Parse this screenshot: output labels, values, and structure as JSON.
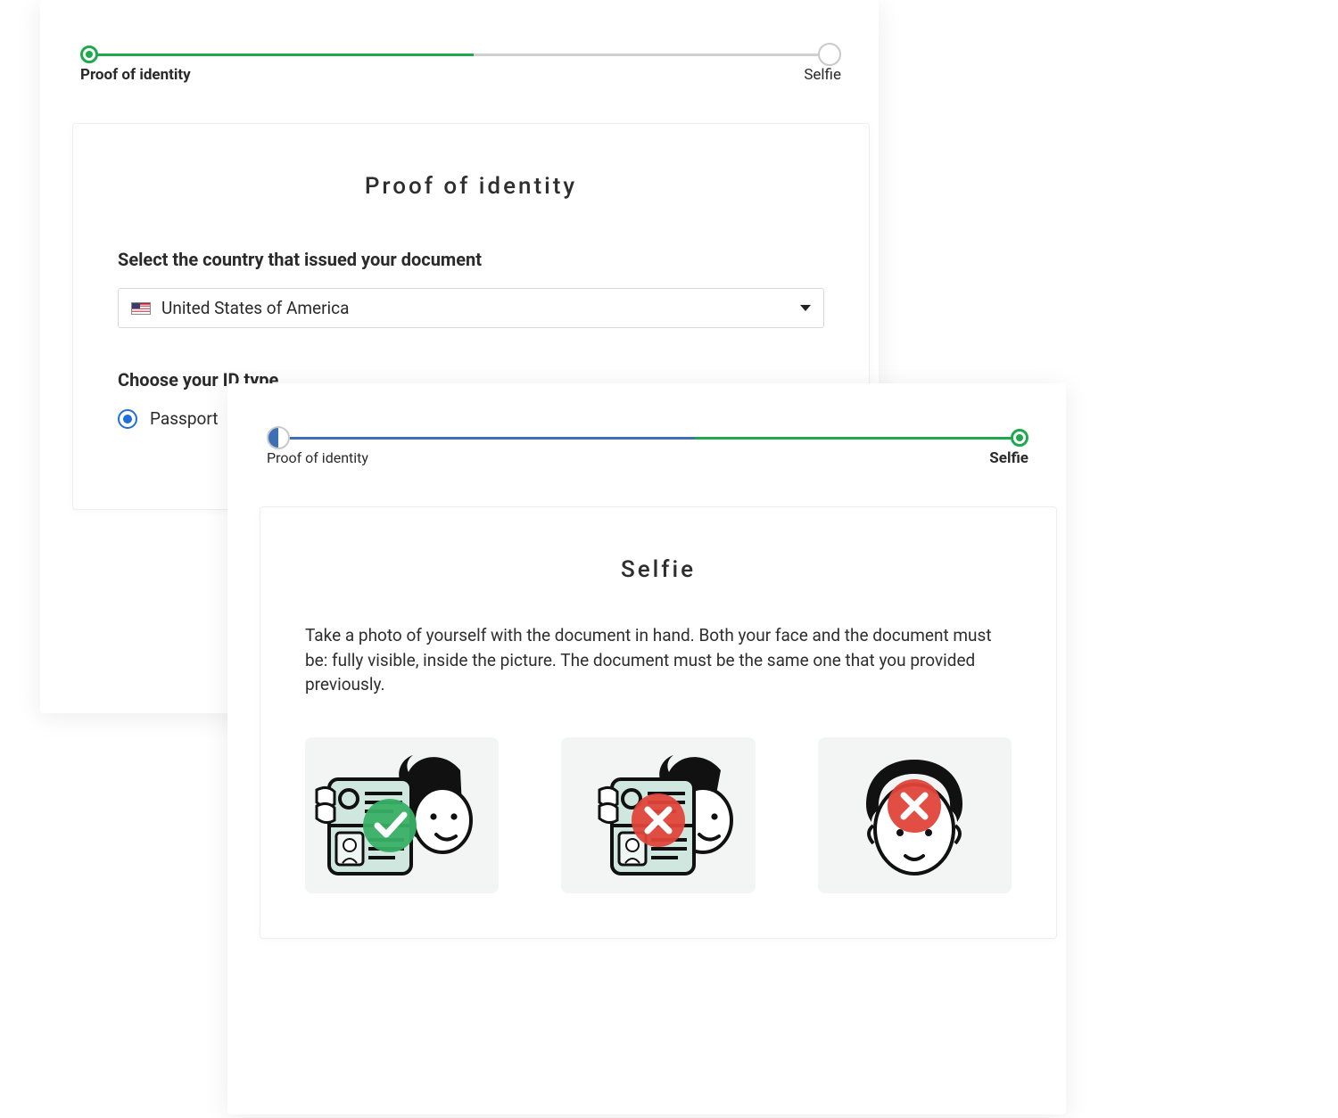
{
  "colors": {
    "green": "#1fa94e",
    "blue": "#3d6fb5",
    "radio_blue": "#1e6fd6",
    "error_red": "#e0453a"
  },
  "screenA": {
    "step_label_1": "Proof of identity",
    "step_label_2": "Selfie",
    "title": "Proof of identity",
    "country_prompt": "Select the country that issued your document",
    "country_selected": "United States of America",
    "id_type_prompt": "Choose your ID type",
    "id_type_option_1": "Passport"
  },
  "screenB": {
    "step_label_1": "Proof of identity",
    "step_label_2": "Selfie",
    "title": "Selfie",
    "description": "Take a photo of yourself with the document in hand. Both your face and the document must be: fully visible, inside the picture. The document must be the same one that you provided previously.",
    "examples": {
      "correct": "selfie-with-doc-correct",
      "wrong_covered": "selfie-with-doc-face-covered",
      "wrong_nodoc": "selfie-no-document"
    }
  }
}
